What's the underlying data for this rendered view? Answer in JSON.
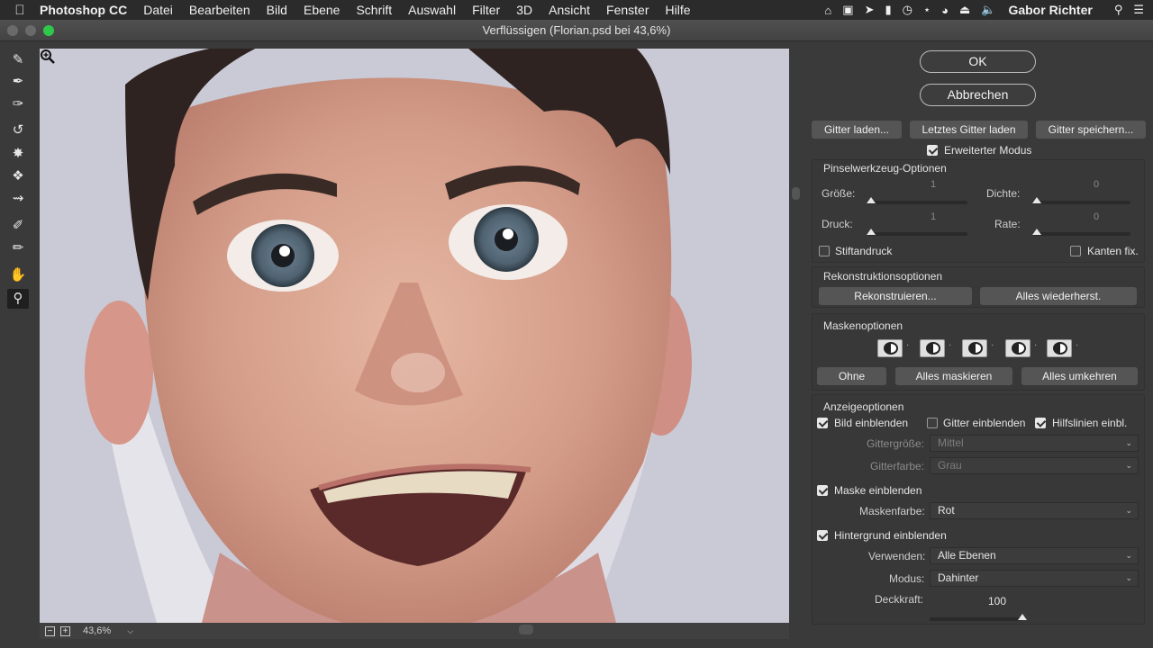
{
  "menubar": {
    "app": "Photoshop CC",
    "items": [
      "Datei",
      "Bearbeiten",
      "Bild",
      "Ebene",
      "Schrift",
      "Auswahl",
      "Filter",
      "3D",
      "Ansicht",
      "Fenster",
      "Hilfe"
    ],
    "user": "Gabor Richter"
  },
  "window": {
    "title": "Verflüssigen (Florian.psd bei 43,6%)"
  },
  "buttons": {
    "ok": "OK",
    "cancel": "Abbrechen",
    "load_mesh": "Gitter laden...",
    "load_last_mesh": "Letztes Gitter laden",
    "save_mesh": "Gitter speichern..."
  },
  "advanced_mode": {
    "label": "Erweiterter Modus",
    "checked": true
  },
  "brush_options": {
    "title": "Pinselwerkzeug-Optionen",
    "size": {
      "label": "Größe:",
      "value": "1"
    },
    "density": {
      "label": "Dichte:",
      "value": "0"
    },
    "pressure": {
      "label": "Druck:",
      "value": "1"
    },
    "rate": {
      "label": "Rate:",
      "value": "0"
    },
    "stylus": {
      "label": "Stiftandruck",
      "checked": false
    },
    "pin_edges": {
      "label": "Kanten fix.",
      "checked": false
    }
  },
  "reconstruct": {
    "title": "Rekonstruktionsoptionen",
    "reconstruct_btn": "Rekonstruieren...",
    "restore_all_btn": "Alles wiederherst."
  },
  "mask": {
    "title": "Maskenoptionen",
    "none_btn": "Ohne",
    "mask_all_btn": "Alles maskieren",
    "invert_all_btn": "Alles umkehren"
  },
  "view": {
    "title": "Anzeigeoptionen",
    "show_image": {
      "label": "Bild einblenden",
      "checked": true
    },
    "show_mesh": {
      "label": "Gitter einblenden",
      "checked": false
    },
    "show_guides": {
      "label": "Hilfslinien einbl.",
      "checked": true
    },
    "mesh_size": {
      "label": "Gittergröße:",
      "value": "Mittel"
    },
    "mesh_color": {
      "label": "Gitterfarbe:",
      "value": "Grau"
    },
    "show_mask": {
      "label": "Maske einblenden",
      "checked": true
    },
    "mask_color": {
      "label": "Maskenfarbe:",
      "value": "Rot"
    },
    "show_backdrop": {
      "label": "Hintergrund einblenden",
      "checked": true
    },
    "use": {
      "label": "Verwenden:",
      "value": "Alle Ebenen"
    },
    "mode": {
      "label": "Modus:",
      "value": "Dahinter"
    },
    "opacity": {
      "label": "Deckkraft:",
      "value": "100"
    }
  },
  "status": {
    "zoom": "43,6%"
  },
  "icons": {
    "tools": [
      "forward-warp-icon",
      "reconstruct-icon",
      "smooth-icon",
      "twirl-icon",
      "pucker-icon",
      "bloat-icon",
      "push-left-icon",
      "freeze-mask-icon",
      "thaw-mask-icon",
      "hand-icon",
      "zoom-icon"
    ]
  },
  "colors": {
    "window_bg": "#3a3a3a",
    "traffic_green": "#2fc84a"
  }
}
